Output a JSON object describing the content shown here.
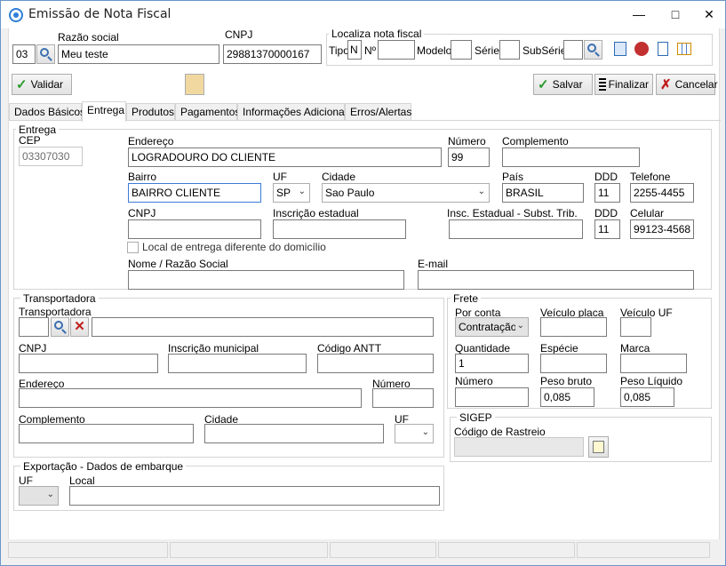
{
  "window": {
    "title": "Emissão de Nota Fiscal"
  },
  "header": {
    "razao_label": "Razão social",
    "cnpj_label": "CNPJ",
    "code": "03",
    "razao": "Meu teste",
    "cnpj": "29881370000167",
    "localiza": {
      "title": "Localiza nota fiscal",
      "tipo_label": "Tipo",
      "tipo_value": "N",
      "num_label": "Nº",
      "modelo_label": "Modelo",
      "serie_label": "Série",
      "subserie_label": "SubSérie"
    }
  },
  "toolbar": {
    "validar": "Validar",
    "salvar": "Salvar",
    "finalizar": "Finalizar",
    "cancelar": "Cancelar"
  },
  "tabs": [
    "Dados Básicos",
    "Entrega",
    "Produtos",
    "Pagamentos",
    "Informações Adicionais",
    "Erros/Alertas"
  ],
  "entrega": {
    "group_title": "Entrega",
    "cep_label": "CEP",
    "cep": "03307030",
    "endereco_label": "Endereço",
    "endereco": "LOGRADOURO DO CLIENTE",
    "numero_label": "Número",
    "numero": "99",
    "complemento_label": "Complemento",
    "complemento": "",
    "bairro_label": "Bairro",
    "bairro": "BAIRRO CLIENTE",
    "uf_label": "UF",
    "uf": "SP",
    "cidade_label": "Cidade",
    "cidade": "Sao Paulo",
    "pais_label": "País",
    "pais": "BRASIL",
    "ddd_label": "DDD",
    "ddd_tel": "11",
    "telefone_label": "Telefone",
    "telefone": "2255-4455",
    "cnpj_label": "CNPJ",
    "ie_label": "Inscrição estadual",
    "ie_st_label": "Insc. Estadual - Subst. Trib.",
    "ddd2_label": "DDD",
    "ddd_cel": "11",
    "celular_label": "Celular",
    "celular": "99123-4568",
    "local_diferente_label": "Local de entrega diferente do domicílio",
    "nome_label": "Nome / Razão Social",
    "email_label": "E-mail"
  },
  "transportadora": {
    "group_title": "Transportadora",
    "transp_label": "Transportadora",
    "cnpj_label": "CNPJ",
    "im_label": "Inscrição municipal",
    "antt_label": "Código ANTT",
    "endereco_label": "Endereço",
    "numero_label": "Número",
    "complemento_label": "Complemento",
    "cidade_label": "Cidade",
    "uf_label": "UF"
  },
  "frete": {
    "group_title": "Frete",
    "por_conta_label": "Por conta",
    "por_conta": "Contratação",
    "placa_label": "Veículo placa",
    "veic_uf_label": "Veículo UF",
    "quantidade_label": "Quantidade",
    "quantidade": "1",
    "especie_label": "Espécie",
    "marca_label": "Marca",
    "numero_label": "Número",
    "peso_bruto_label": "Peso bruto",
    "peso_bruto": "0,085",
    "peso_liquido_label": "Peso Líquido",
    "peso_liquido": "0,085"
  },
  "sigep": {
    "group_title": "SIGEP",
    "rastreio_label": "Código de Rastreio"
  },
  "exportacao": {
    "group_title": "Exportação - Dados de embarque",
    "uf_label": "UF",
    "local_label": "Local"
  }
}
